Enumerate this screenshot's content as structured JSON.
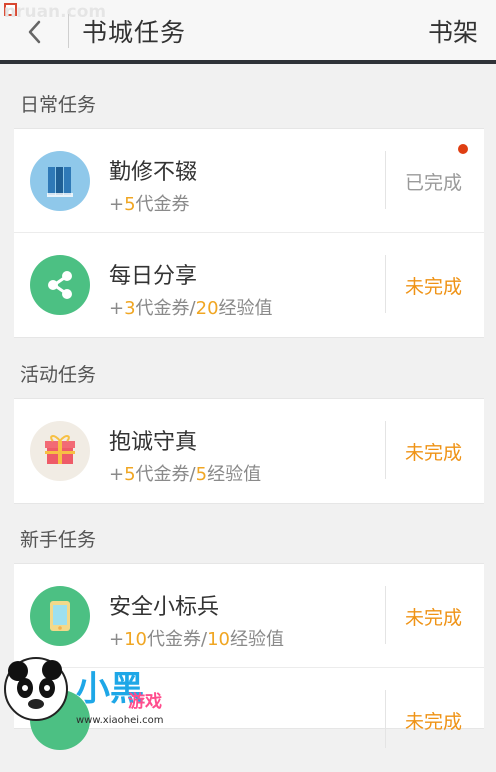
{
  "header": {
    "title": "书城任务",
    "right_action": "书架",
    "back_label": "<"
  },
  "watermark": {
    "top_text": "nruan.com",
    "logo_text": "小黑游戏",
    "logo_url_text": "www.xiaohei.com"
  },
  "sections": [
    {
      "title": "日常任务",
      "items": [
        {
          "title": "勤修不辍",
          "reward_prefix": "+",
          "reward_num": "5",
          "reward_unit": "代金券",
          "reward_sep": "",
          "reward_num2": "",
          "reward_unit2": "",
          "status": "已完成",
          "icon": "books-icon",
          "icon_bg": "#8fc8ea"
        },
        {
          "title": "每日分享",
          "reward_prefix": "+",
          "reward_num": "3",
          "reward_unit": "代金券",
          "reward_sep": "/",
          "reward_num2": "20",
          "reward_unit2": "经验值",
          "status": "未完成",
          "icon": "share-icon",
          "icon_bg": "#4cc083"
        }
      ]
    },
    {
      "title": "活动任务",
      "items": [
        {
          "title": "抱诚守真",
          "reward_prefix": "+",
          "reward_num": "5",
          "reward_unit": "代金券",
          "reward_sep": "/",
          "reward_num2": "5",
          "reward_unit2": "经验值",
          "status": "未完成",
          "icon": "gift-icon",
          "icon_bg": "#f1ece4"
        }
      ]
    },
    {
      "title": "新手任务",
      "items": [
        {
          "title": "安全小标兵",
          "reward_prefix": "+",
          "reward_num": "10",
          "reward_unit": "代金券",
          "reward_sep": "/",
          "reward_num2": "10",
          "reward_unit2": "经验值",
          "status": "未完成",
          "icon": "phone-icon",
          "icon_bg": "#4cc083"
        },
        {
          "title": "",
          "reward_prefix": "",
          "reward_num": "",
          "reward_unit": "",
          "reward_sep": "",
          "reward_num2": "",
          "reward_unit2": "",
          "status": "未完成",
          "icon": "generic-task-icon",
          "icon_bg": "#4cc083"
        }
      ]
    }
  ],
  "colors": {
    "accent_orange": "#ef9316",
    "reward_orange": "#f0a623",
    "done_gray": "#9a9a9a",
    "notification_red": "#df3e12"
  }
}
